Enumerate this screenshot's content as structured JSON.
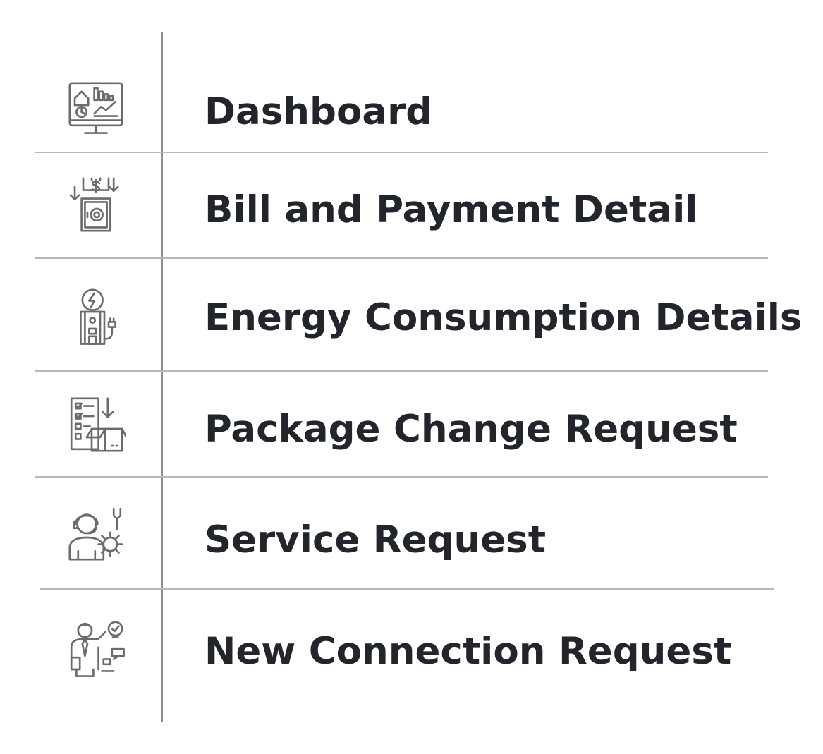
{
  "menu": {
    "items": [
      {
        "label": "Dashboard",
        "icon": "dashboard-monitor-icon"
      },
      {
        "label": "Bill and Payment Detail",
        "icon": "bill-payment-safe-icon"
      },
      {
        "label": "Energy Consumption Details",
        "icon": "energy-meter-icon"
      },
      {
        "label": "Package Change Request",
        "icon": "package-checklist-icon"
      },
      {
        "label": "Service Request",
        "icon": "support-agent-tools-icon"
      },
      {
        "label": "New Connection Request",
        "icon": "presenter-idea-icon"
      }
    ]
  },
  "colors": {
    "text": "#23252d",
    "icon": "#6b6b6b",
    "divider": "#b7b7b7",
    "vertical_divider": "#8f8f8f",
    "background": "#ffffff"
  }
}
